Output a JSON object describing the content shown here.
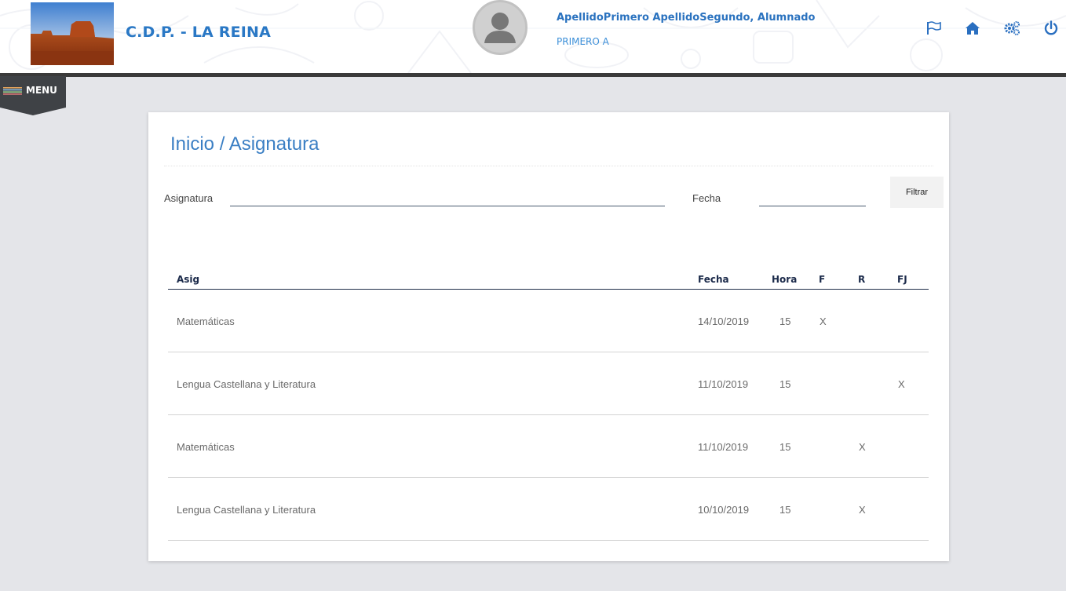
{
  "header": {
    "school_name": "C.D.P. - LA REINA",
    "user_name": "ApellidoPrimero ApellidoSegundo, Alumnado",
    "user_class": "PRIMERO A",
    "icons": [
      "flag-icon",
      "home-icon",
      "settings-icon",
      "power-icon"
    ],
    "accent_color": "#2a78c5"
  },
  "menu": {
    "label": "MENU"
  },
  "page": {
    "title": "Inicio / Asignatura"
  },
  "filters": {
    "subject_label": "Asignatura",
    "subject_value": "",
    "date_label": "Fecha",
    "date_value": "",
    "filter_button": "Filtrar"
  },
  "table": {
    "headers": {
      "asig": "Asig",
      "fecha": "Fecha",
      "hora": "Hora",
      "f": "F",
      "r": "R",
      "fj": "FJ"
    },
    "rows": [
      {
        "asig": "Matemáticas",
        "fecha": "14/10/2019",
        "hora": "15",
        "f": "X",
        "r": "",
        "fj": ""
      },
      {
        "asig": "Lengua Castellana y Literatura",
        "fecha": "11/10/2019",
        "hora": "15",
        "f": "",
        "r": "",
        "fj": "X"
      },
      {
        "asig": "Matemáticas",
        "fecha": "11/10/2019",
        "hora": "15",
        "f": "",
        "r": "X",
        "fj": ""
      },
      {
        "asig": "Lengua Castellana y Literatura",
        "fecha": "10/10/2019",
        "hora": "15",
        "f": "",
        "r": "X",
        "fj": ""
      }
    ]
  }
}
